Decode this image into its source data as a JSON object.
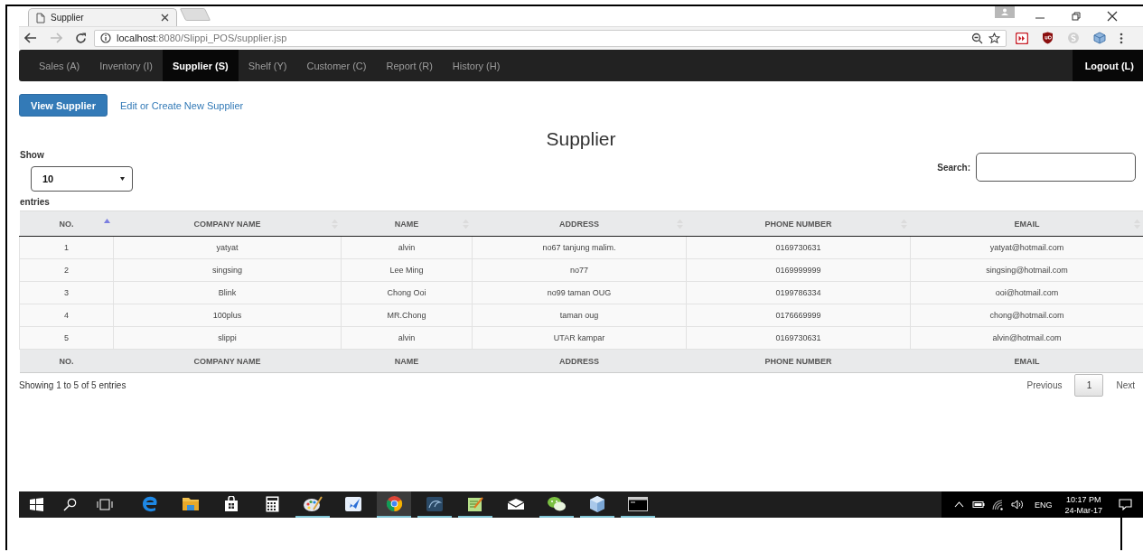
{
  "browser": {
    "tab_title": "Supplier",
    "url_host": "localhost",
    "url_path": ":8080/Slippi_POS/supplier.jsp"
  },
  "navbar": {
    "items": [
      {
        "label": "Sales (A)",
        "selected": false
      },
      {
        "label": "Inventory (I)",
        "selected": false
      },
      {
        "label": "Supplier (S)",
        "selected": true
      },
      {
        "label": "Shelf (Y)",
        "selected": false
      },
      {
        "label": "Customer (C)",
        "selected": false
      },
      {
        "label": "Report (R)",
        "selected": false
      },
      {
        "label": "History (H)",
        "selected": false
      }
    ],
    "logout": "Logout (L)"
  },
  "actions": {
    "primary": "View Supplier",
    "link": "Edit or Create New Supplier"
  },
  "title": "Supplier",
  "length_menu": {
    "show_label": "Show",
    "value": "10",
    "entries_label": "entries"
  },
  "search": {
    "label": "Search:"
  },
  "table": {
    "columns": [
      {
        "label": "NO.",
        "sorted": true
      },
      {
        "label": "COMPANY NAME",
        "sorted": false
      },
      {
        "label": "NAME",
        "sorted": false
      },
      {
        "label": "ADDRESS",
        "sorted": false
      },
      {
        "label": "PHONE NUMBER",
        "sorted": false
      },
      {
        "label": "EMAIL",
        "sorted": false
      }
    ],
    "rows": [
      [
        "1",
        "yatyat",
        "alvin",
        "no67 tanjung malim.",
        "0169730631",
        "yatyat@hotmail.com"
      ],
      [
        "2",
        "singsing",
        "Lee Ming",
        "no77",
        "0169999999",
        "singsing@hotmail.com"
      ],
      [
        "3",
        "Blink",
        "Chong Ooi",
        "no99 taman OUG",
        "0199786334",
        "ooi@hotmail.com"
      ],
      [
        "4",
        "100plus",
        "MR.Chong",
        "taman oug",
        "0176669999",
        "chong@hotmail.com"
      ],
      [
        "5",
        "slippi",
        "alvin",
        "UTAR kampar",
        "0169730631",
        "alvin@hotmail.com"
      ]
    ],
    "footer": [
      "NO.",
      "COMPANY NAME",
      "NAME",
      "ADDRESS",
      "PHONE NUMBER",
      "EMAIL"
    ]
  },
  "info": "Showing 1 to 5 of 5 entries",
  "pagination": {
    "previous": "Previous",
    "pages": [
      {
        "label": "1",
        "selected": true
      }
    ],
    "next": "Next"
  },
  "taskbar": {
    "apps": [
      {
        "kind": "edge",
        "running": false,
        "active": false
      },
      {
        "kind": "folder",
        "running": false,
        "active": false
      },
      {
        "kind": "store",
        "running": false,
        "active": false
      },
      {
        "kind": "calculator",
        "running": false,
        "active": false
      },
      {
        "kind": "palette",
        "running": true,
        "active": false
      },
      {
        "kind": "bird",
        "running": false,
        "active": false
      },
      {
        "kind": "chrome",
        "running": true,
        "active": true
      },
      {
        "kind": "dolphin",
        "running": true,
        "active": false
      },
      {
        "kind": "notepad",
        "running": true,
        "active": false
      },
      {
        "kind": "mail",
        "running": false,
        "active": false
      },
      {
        "kind": "chat",
        "running": true,
        "active": false
      },
      {
        "kind": "cube",
        "running": true,
        "active": false
      },
      {
        "kind": "terminal",
        "running": true,
        "active": false
      }
    ],
    "language": "ENG",
    "time": "10:17 PM",
    "date": "24-Mar-17"
  }
}
